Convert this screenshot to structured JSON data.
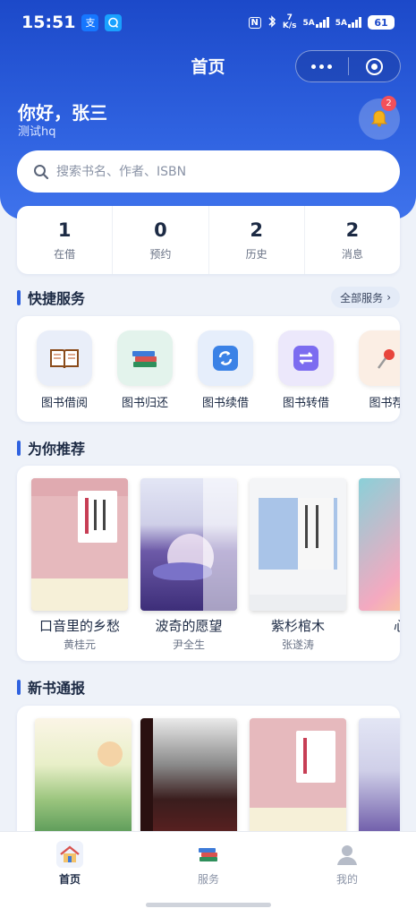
{
  "status": {
    "time": "15:51",
    "app1": "支",
    "speed_value": "7",
    "speed_unit": "K/s",
    "sig1": "5A",
    "sig2": "5A",
    "battery": "61"
  },
  "header": {
    "title": "首页"
  },
  "user": {
    "greeting": "你好，张三",
    "subtitle": "测试hq",
    "notification_count": "2"
  },
  "search": {
    "placeholder": "搜索书名、作者、ISBN"
  },
  "stats": [
    {
      "value": "1",
      "label": "在借"
    },
    {
      "value": "0",
      "label": "预约"
    },
    {
      "value": "2",
      "label": "历史"
    },
    {
      "value": "2",
      "label": "消息"
    }
  ],
  "quick": {
    "title": "快捷服务",
    "all_label": "全部服务",
    "items": [
      {
        "label": "图书借阅",
        "icon": "open-book-icon"
      },
      {
        "label": "图书归还",
        "icon": "book-stack-icon"
      },
      {
        "label": "图书续借",
        "icon": "renew-icon"
      },
      {
        "label": "图书转借",
        "icon": "transfer-icon"
      },
      {
        "label": "图书荐",
        "icon": "pin-icon"
      }
    ]
  },
  "recommend": {
    "title": "为你推荐",
    "books": [
      {
        "title": "口音里的乡愁",
        "author": "黄桂元"
      },
      {
        "title": "波奇的愿望",
        "author": "尹全生"
      },
      {
        "title": "紫杉棺木",
        "author": "张遂涛"
      },
      {
        "title": "心灵",
        "author": ""
      }
    ]
  },
  "newbooks": {
    "title": "新书通报"
  },
  "tabs": [
    {
      "label": "首页",
      "icon": "home-icon"
    },
    {
      "label": "服务",
      "icon": "books-icon"
    },
    {
      "label": "我的",
      "icon": "user-icon"
    }
  ],
  "colors": {
    "primary": "#2f62e0",
    "active_tab": "#1c2a44",
    "inactive_tab": "#8a93a6",
    "badge": "#f2505a"
  }
}
